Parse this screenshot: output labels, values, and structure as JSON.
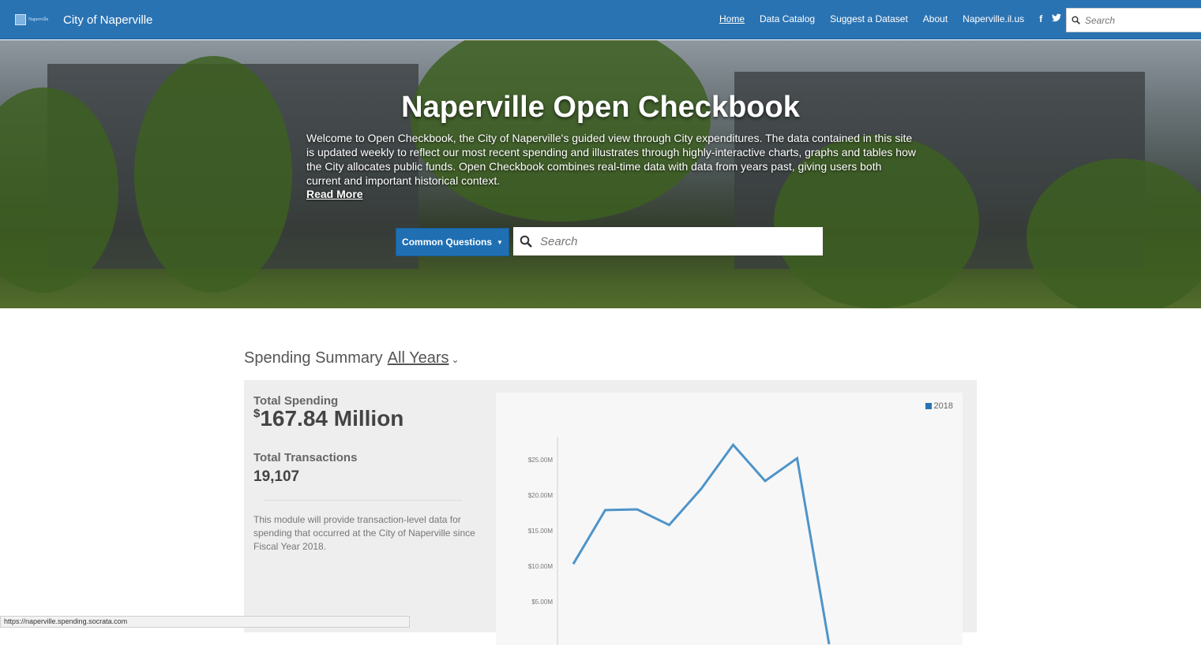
{
  "header": {
    "brand_name": "City of Naperville",
    "logo_text": "Naperville",
    "nav": [
      {
        "label": "Home"
      },
      {
        "label": "Data Catalog"
      },
      {
        "label": "Suggest a Dataset"
      },
      {
        "label": "About"
      },
      {
        "label": "Naperville.il.us"
      }
    ],
    "search_placeholder": "Search",
    "colors": {
      "bar": "#2a73b3"
    }
  },
  "hero": {
    "title": "Naperville Open Checkbook",
    "description": "Welcome to Open Checkbook, the City of Naperville's guided view through City expenditures. The data contained in this site is updated weekly to reflect our most recent spending and illustrates through highly-interactive charts, graphs and tables how the City allocates public funds. Open Checkbook combines real-time data with data from years past, giving users both current and important historical context.",
    "read_more": "Read More",
    "common_questions": "Common Questions",
    "search_placeholder": "Search"
  },
  "summary": {
    "title": "Spending Summary",
    "year_filter": "All Years",
    "total_spending_label": "Total Spending",
    "total_spending_currency": "$",
    "total_spending_value": "167.84 Million",
    "total_transactions_label": "Total Transactions",
    "total_transactions_value": "19,107",
    "description": "This module will provide transaction-level data for spending that occurred at the City of Naperville since Fiscal Year 2018."
  },
  "chart_data": {
    "type": "line",
    "series": [
      {
        "name": "2018",
        "values": [
          10.3,
          17.9,
          18.0,
          15.8,
          20.9,
          27.1,
          22.0,
          25.2,
          -1.0
        ]
      }
    ],
    "y_ticks": [
      "$5.00M",
      "$10.00M",
      "$15.00M",
      "$20.00M",
      "$25.00M"
    ],
    "y_tick_values": [
      5,
      10,
      15,
      20,
      25
    ],
    "ylim": [
      0,
      30
    ],
    "color": "#4f94c8"
  },
  "statusbar": {
    "url": "https://naperville.spending.socrata.com"
  }
}
